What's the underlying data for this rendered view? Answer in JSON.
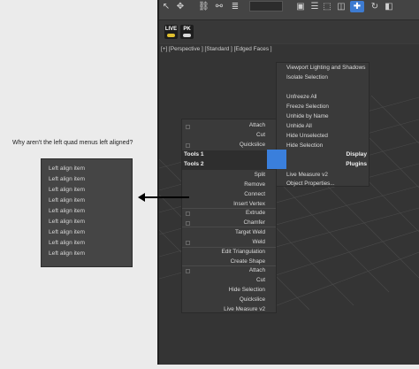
{
  "question": "Why aren't the left quad menus left aligned?",
  "left_menu": {
    "items": [
      "Left align item",
      "Left align item",
      "Left align item",
      "Left align item",
      "Left align item",
      "Left align item",
      "Left align item",
      "Left align item",
      "Left align item"
    ]
  },
  "arrow": {
    "icon": "left-arrow-icon"
  },
  "app": {
    "plugins": [
      {
        "label": "LIVE",
        "icon": "live-plugin-icon"
      },
      {
        "label": "PK",
        "icon": "pk-plugin-icon"
      }
    ],
    "viewport_label": "[+] [Perspective ] [Standard ] [Edged Faces ]"
  },
  "quad_left": {
    "top_items": [
      "Attach",
      "Cut",
      "Quickslice"
    ],
    "headers": [
      {
        "left": "Tools 1",
        "right": "Display"
      },
      {
        "left": "Tools 2",
        "right": "Plugins"
      }
    ],
    "bottom_items": [
      "Split",
      "Remove",
      "Connect",
      "Insert Vertex",
      "Extrude",
      "Chamfer",
      "Target Weld",
      "Weld",
      "Edit Triangulation",
      "Create Shape",
      "Attach",
      "Cut",
      "Hide Selection",
      "Quickslice",
      "Live Measure v2"
    ]
  },
  "quad_right": {
    "top_items": [
      "Viewport Lighting and Shadows",
      "Isolate Selection",
      "",
      "Unfreeze All",
      "Freeze Selection",
      "Unhide by Name",
      "Unhide All",
      "Hide Unselected",
      "Hide Selection"
    ],
    "bottom_items": [
      "Live Measure v2",
      "Object Properties..."
    ]
  },
  "colors": {
    "accent": "#3a7fdc",
    "menu_bg": "#3a3a3a"
  }
}
